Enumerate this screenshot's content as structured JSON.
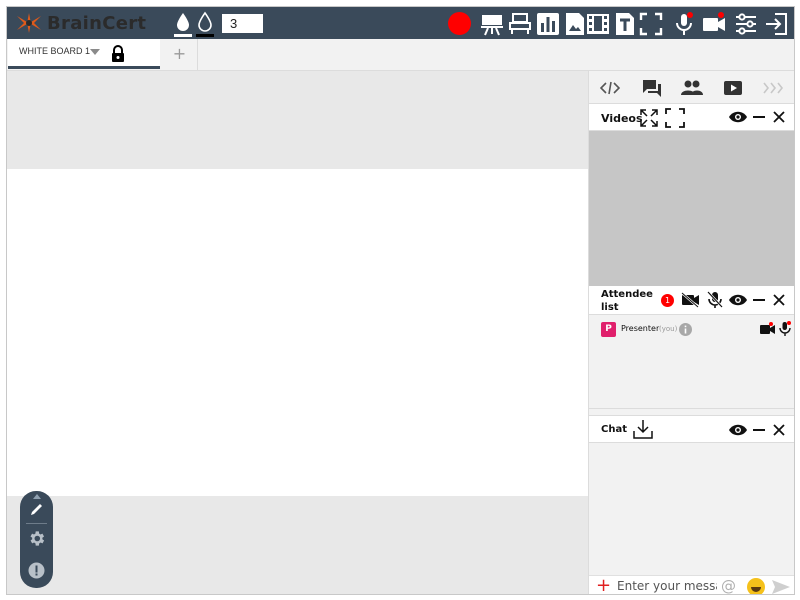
{
  "app": {
    "brand": "BrainCert",
    "page_number": "3",
    "colors": {
      "topbar": "#3a4a5a",
      "record": "#ff0000",
      "avatar": "#e0206c",
      "accent": "#e02020"
    }
  },
  "toolbar": {
    "icons": [
      "white-drop-icon",
      "black-drop-icon",
      "record-icon",
      "presentation-icon",
      "classroom-icon",
      "poll-icon",
      "image-icon",
      "video-file-icon",
      "text-icon",
      "fullscreen-icon",
      "microphone-icon",
      "camera-icon",
      "settings-sliders-icon",
      "exit-icon"
    ]
  },
  "tabs": [
    {
      "label": "WHITE BOARD 1",
      "locked": true
    }
  ],
  "tab_add_label": "+",
  "right_panel": {
    "tab_icons": [
      "code-icon",
      "chat-icon",
      "people-icon",
      "youtube-icon",
      "more-icon"
    ],
    "videos": {
      "title": "Videos"
    },
    "attendees": {
      "title_line1": "Attendee",
      "title_line2": "list",
      "count": "1",
      "items": [
        {
          "initial": "P",
          "name": "Presenter",
          "tag": "(you)"
        }
      ]
    },
    "chat": {
      "title": "Chat",
      "placeholder": "Enter your message",
      "at": "@",
      "plus": "+"
    }
  }
}
